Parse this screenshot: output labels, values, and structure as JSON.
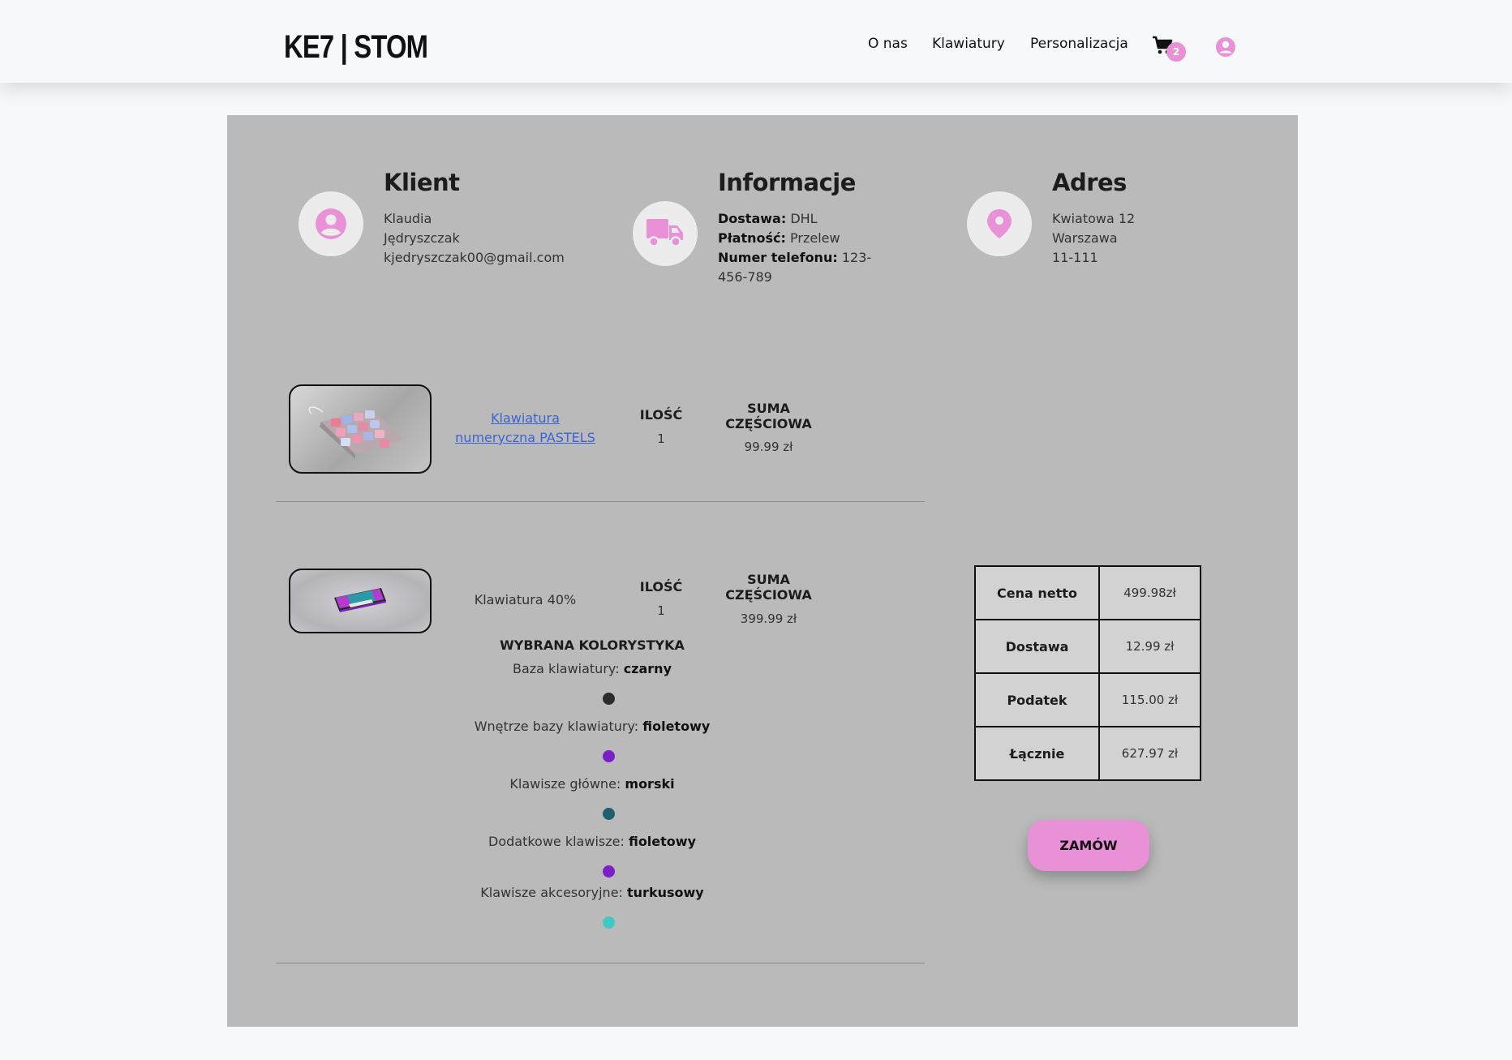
{
  "header": {
    "logo": "KE7 | STOM",
    "nav": [
      "O nas",
      "Klawiatury",
      "Personalizacja"
    ],
    "cart_count": "2"
  },
  "client": {
    "title": "Klient",
    "first_name": "Klaudia",
    "last_name": "Jędryszczak",
    "email": "kjedryszczak00@gmail.com"
  },
  "info": {
    "title": "Informacje",
    "delivery_label": "Dostawa:",
    "delivery_value": "DHL",
    "payment_label": "Płatność:",
    "payment_value": "Przelew",
    "phone_label": "Numer telefonu:",
    "phone_value_line1": "123-",
    "phone_value_line2": "456-789"
  },
  "address": {
    "title": "Adres",
    "street": "Kwiatowa 12",
    "city": "Warszawa",
    "postal": "11-111"
  },
  "products": [
    {
      "name_line1": "Klawiatura",
      "name_line2": "numeryczna PASTELS",
      "qty_head": "ILOŚĆ",
      "qty": "1",
      "sum_head_line1": "SUMA",
      "sum_head_line2": "CZĘŚCIOWA",
      "sum": "99.99 zł"
    },
    {
      "name": "Klawiatura 40%",
      "qty_head": "ILOŚĆ",
      "qty": "1",
      "sum_head_line1": "SUMA",
      "sum_head_line2": "CZĘŚCIOWA",
      "sum": "399.99 zł"
    }
  ],
  "colors": {
    "heading": "WYBRANA KOLORYSTYKA",
    "items": [
      {
        "label": "Baza klawiatury:",
        "value": "czarny",
        "hex": "#2b2b2b"
      },
      {
        "label": "Wnętrze bazy klawiatury:",
        "value": "fioletowy",
        "hex": "#7b1fc8"
      },
      {
        "label": "Klawisze główne:",
        "value": "morski",
        "hex": "#1f5f6e"
      },
      {
        "label": "Dodatkowe klawisze:",
        "value": "fioletowy",
        "hex": "#7b1fc8"
      },
      {
        "label": "Klawisze akcesoryjne:",
        "value": "turkusowy",
        "hex": "#3ec9c4"
      }
    ]
  },
  "summary": [
    {
      "label": "Cena netto",
      "value": "499.98zł"
    },
    {
      "label": "Dostawa",
      "value": "12.99 zł"
    },
    {
      "label": "Podatek",
      "value": "115.00 zł"
    },
    {
      "label": "Łącznie",
      "value": "627.97 zł"
    }
  ],
  "order_button": "ZAMÓW",
  "accent": "#e991d6"
}
